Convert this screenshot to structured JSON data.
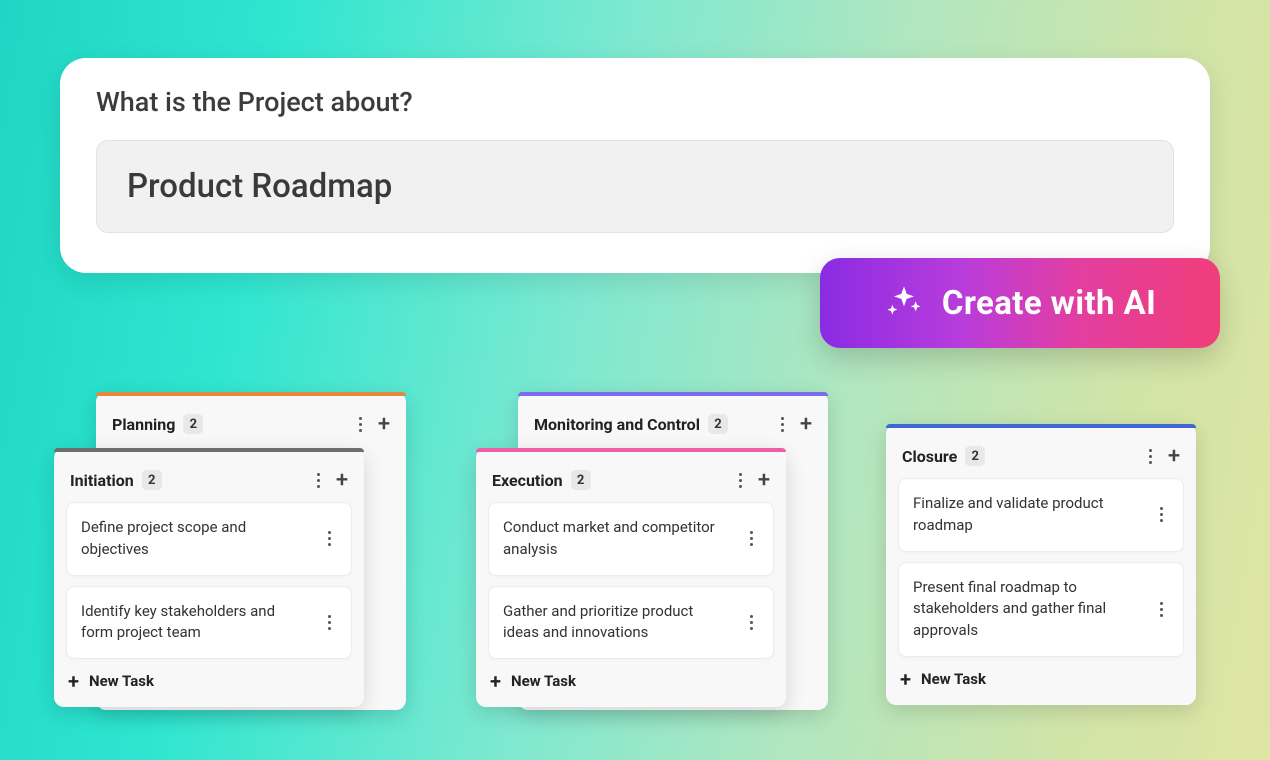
{
  "prompt": {
    "label": "What is the Project about?",
    "value": "Product Roadmap"
  },
  "ai_button": {
    "label": "Create with AI"
  },
  "columns": {
    "planning": {
      "title": "Planning",
      "count": "2"
    },
    "initiation": {
      "title": "Initiation",
      "count": "2",
      "tasks": [
        "Define project scope and objectives",
        "Identify key stakeholders and form project team"
      ],
      "new_task_label": "New Task"
    },
    "monitoring": {
      "title": "Monitoring and Control",
      "count": "2"
    },
    "execution": {
      "title": "Execution",
      "count": "2",
      "tasks": [
        "Conduct market and competitor analysis",
        "Gather and prioritize product ideas and innovations"
      ],
      "new_task_label": "New Task"
    },
    "closure": {
      "title": "Closure",
      "count": "2",
      "tasks": [
        "Finalize and validate product roadmap",
        "Present final roadmap to stakeholders and gather final approvals"
      ],
      "new_task_label": "New Task"
    }
  }
}
